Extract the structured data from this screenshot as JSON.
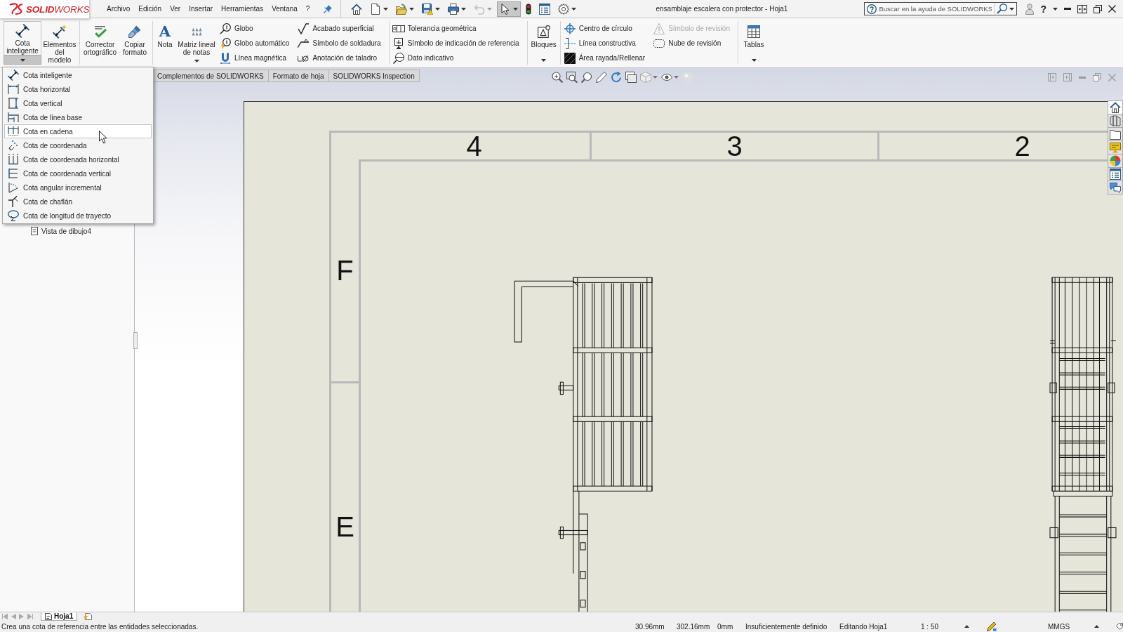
{
  "title_bar": {
    "logo": "**SOLID**WORKS",
    "menu": [
      "Archivo",
      "Edición",
      "Ver",
      "Insertar",
      "Herramientas",
      "Ventana",
      "?"
    ],
    "quick_access": [
      {
        "pressed": false,
        "disabled": false
      },
      {
        "pressed": false,
        "disabled": false
      },
      {
        "pressed": false,
        "disabled": false
      },
      {
        "pressed": false,
        "disabled": false
      },
      {
        "pressed": false,
        "disabled": false
      },
      {
        "pressed": false,
        "disabled": true
      },
      {
        "pressed": true,
        "disabled": false
      },
      {
        "pressed": false,
        "disabled": false
      },
      {
        "pressed": false,
        "disabled": false
      },
      {
        "pressed": false,
        "disabled": false
      }
    ],
    "document_title": "ensamblaje escalera con protector - Hoja1",
    "search": {
      "placeholder": "Buscar en la ayuda de SOLIDWORKS"
    },
    "help": "?"
  },
  "ribbon": {
    "groups": [
      {
        "items": [
          {
            "kind": "dropdown",
            "label": "Cota inteligente",
            "expanded": true
          },
          {
            "kind": "large",
            "label": "Elementos del modelo"
          }
        ]
      },
      {
        "items": [
          {
            "kind": "large",
            "label": "Corrector ortográfico"
          },
          {
            "kind": "large",
            "label": "Copiar formato"
          }
        ]
      },
      {
        "items": [
          {
            "kind": "large",
            "label": "Nota",
            "glyph": "A"
          },
          {
            "kind": "dropdown",
            "label": "Matriz lineal de notas",
            "expanded": false
          },
          {
            "kind": "stack",
            "items": [
              {
                "label": "Globo",
                "disabled": false
              },
              {
                "label": "Globo automático",
                "disabled": false
              },
              {
                "label": "Línea magnética",
                "disabled": false
              }
            ]
          },
          {
            "kind": "stack",
            "items": [
              {
                "label": "Acabado superficial",
                "disabled": false
              },
              {
                "label": "Símbolo de soldadura",
                "disabled": false
              },
              {
                "label": "Anotación de taladro",
                "disabled": false
              }
            ]
          }
        ]
      },
      {
        "items": [
          {
            "kind": "stack",
            "items": [
              {
                "label": "Tolerancia geométrica",
                "disabled": false
              },
              {
                "label": "Símbolo de indicación de referencia",
                "disabled": false
              },
              {
                "label": "Dato indicativo",
                "disabled": false
              }
            ]
          }
        ]
      },
      {
        "items": [
          {
            "kind": "dropdown",
            "label": "Bloques",
            "expanded": false
          }
        ]
      },
      {
        "items": [
          {
            "kind": "stack",
            "items": [
              {
                "label": "Centro de círculo",
                "disabled": false
              },
              {
                "label": "Línea constructiva",
                "disabled": false
              },
              {
                "label": "Área rayada/Rellenar",
                "disabled": false
              }
            ]
          },
          {
            "kind": "stack",
            "items": [
              {
                "label": "Símbolo de revisión",
                "disabled": true
              },
              {
                "label": "Nube de revisión",
                "disabled": false
              }
            ]
          }
        ]
      },
      {
        "items": [
          {
            "kind": "dropdown",
            "label": "Tablas",
            "expanded": false
          }
        ]
      }
    ]
  },
  "dropdown_menu": {
    "items": [
      {
        "label": "Cota inteligente",
        "highlighted": false
      },
      {
        "label": "Cota horizontal",
        "highlighted": false
      },
      {
        "label": "Cota vertical",
        "highlighted": false
      },
      {
        "label": "Cota de línea base",
        "highlighted": false
      },
      {
        "label": "Cota en cadena",
        "highlighted": true
      },
      {
        "label": "Cota de coordenada",
        "highlighted": false
      },
      {
        "label": "Cota de coordenada horizontal",
        "highlighted": false
      },
      {
        "label": "Cota de coordenada vertical",
        "highlighted": false
      },
      {
        "label": "Cota angular incremental",
        "highlighted": false
      },
      {
        "label": "Cota de chaflán",
        "highlighted": false
      },
      {
        "label": "Cota de longitud de trayecto",
        "highlighted": false
      }
    ]
  },
  "command_tabs": [
    {
      "label": "Complementos de SOLIDWORKS",
      "selected": false
    },
    {
      "label": "Formato de hoja",
      "selected": false
    },
    {
      "label": "SOLIDWORKS Inspection",
      "selected": false
    }
  ],
  "feature_tree": {
    "items": [
      {
        "label": "Vista de dibujo4"
      }
    ]
  },
  "drawing_sheet": {
    "zone_columns": [
      "4",
      "3",
      "2"
    ],
    "zone_rows": [
      "F",
      "E"
    ]
  },
  "task_pane": [
    {
      "selected": true
    },
    {
      "selected": false
    },
    {
      "selected": false
    },
    {
      "selected": false
    },
    {
      "selected": false
    },
    {
      "selected": false
    },
    {
      "selected": false
    }
  ],
  "sheet_tabs": [
    {
      "label": "Hoja1",
      "selected": true
    }
  ],
  "status_bar": {
    "message": "Crea una cota de referencia entre las entidades seleccionadas.",
    "fields": [
      "30.96mm",
      "302.16mm",
      "0mm",
      "Insuficientemente definido",
      "Editando Hoja1",
      "1 : 50"
    ],
    "units": "MMGS"
  }
}
